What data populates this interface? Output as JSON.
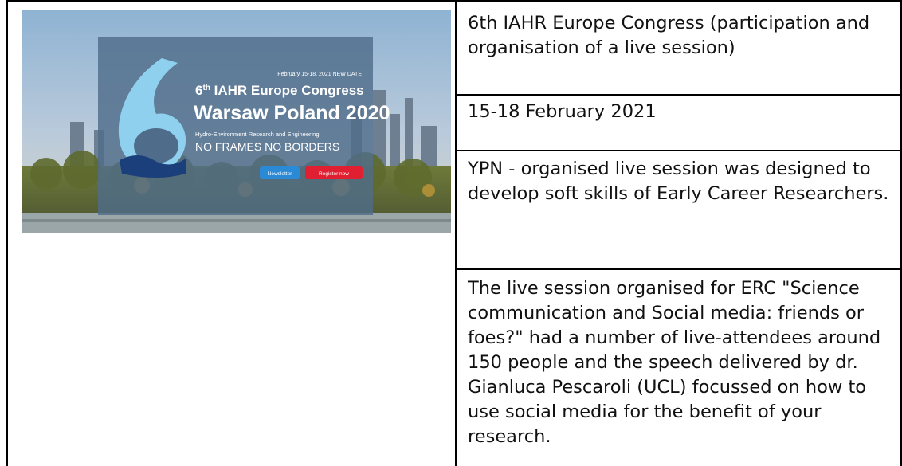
{
  "table": {
    "rows": [
      {
        "text": "6th IAHR Europe Congress (participation and organisation of a live session)"
      },
      {
        "text": "15-18 February 2021"
      },
      {
        "text": "YPN - organised live session was designed to develop soft skills of Early Career Researchers."
      },
      {
        "text": "The live session organised for ERC \"Science communication and Social media: friends or foes?\" had a number of live-attendees around 150 people and the speech delivered by dr. Gianluca Pescaroli (UCL) focussed on how to use social media for the benefit of your research."
      }
    ]
  },
  "banner": {
    "date_note": "February 15-18, 2021 NEW DATE",
    "title_prefix": "th",
    "title_line1": "IAHR Europe Congress",
    "title_line2": "Warsaw Poland 2020",
    "tagline": "Hydro-Environment Research and Engineering",
    "slogan": "NO FRAMES NO BORDERS",
    "newsletter_label": "Newsletter",
    "register_label": "Register now",
    "big_number": "6",
    "colors": {
      "panel": "#4f6d8a",
      "logo_light": "#8fd0ee",
      "logo_dark": "#1b3f7a",
      "newsletter": "#2a8ad6",
      "register": "#e02030"
    }
  }
}
